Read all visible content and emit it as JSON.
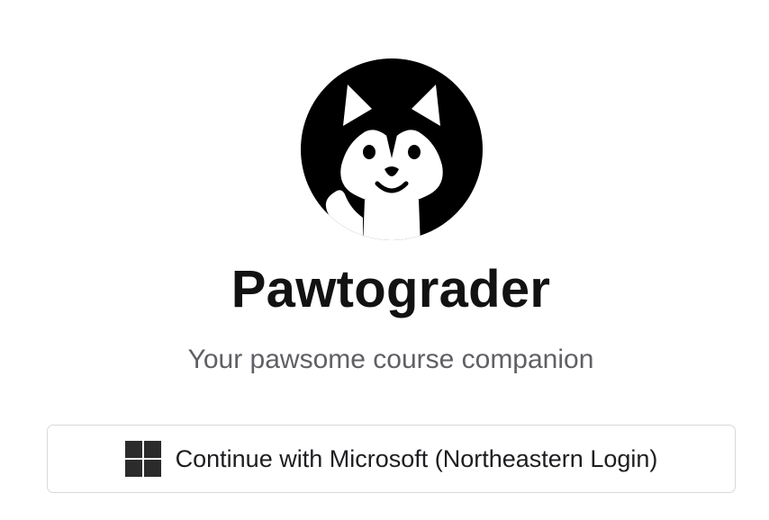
{
  "app": {
    "title": "Pawtograder",
    "tagline": "Your pawsome course companion"
  },
  "logo": {
    "icon": "husky-dog-logo-icon",
    "color": "#000000"
  },
  "login": {
    "button_label": "Continue with Microsoft (Northeastern Login)",
    "icon": "microsoft-windows-icon"
  },
  "colors": {
    "title": "#121212",
    "subtitle": "#5f5f66",
    "button_border": "#d9d9de"
  }
}
